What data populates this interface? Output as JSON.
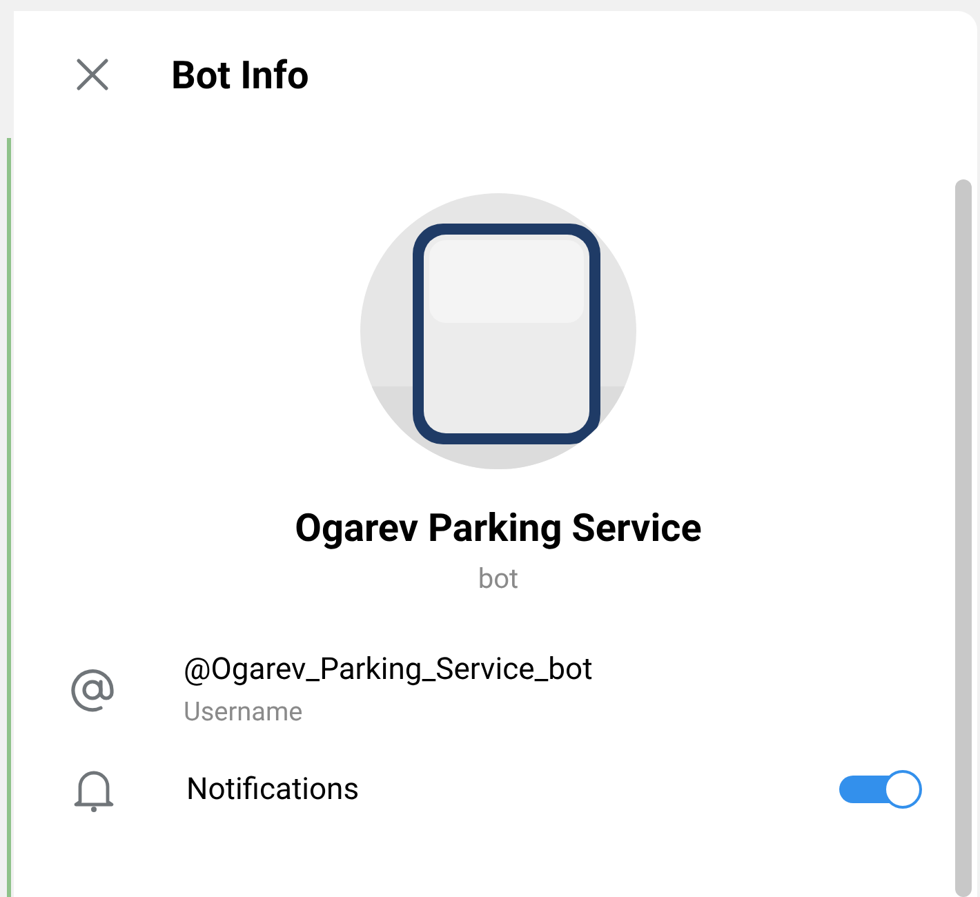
{
  "header": {
    "title": "Bot Info"
  },
  "profile": {
    "name": "Ogarev Parking Service",
    "status": "bot"
  },
  "info_rows": [
    {
      "kind": "username",
      "value": "@Ogarev_Parking_Service_bot",
      "caption": "Username"
    },
    {
      "kind": "notifications",
      "label": "Notifications",
      "on": true
    }
  ]
}
